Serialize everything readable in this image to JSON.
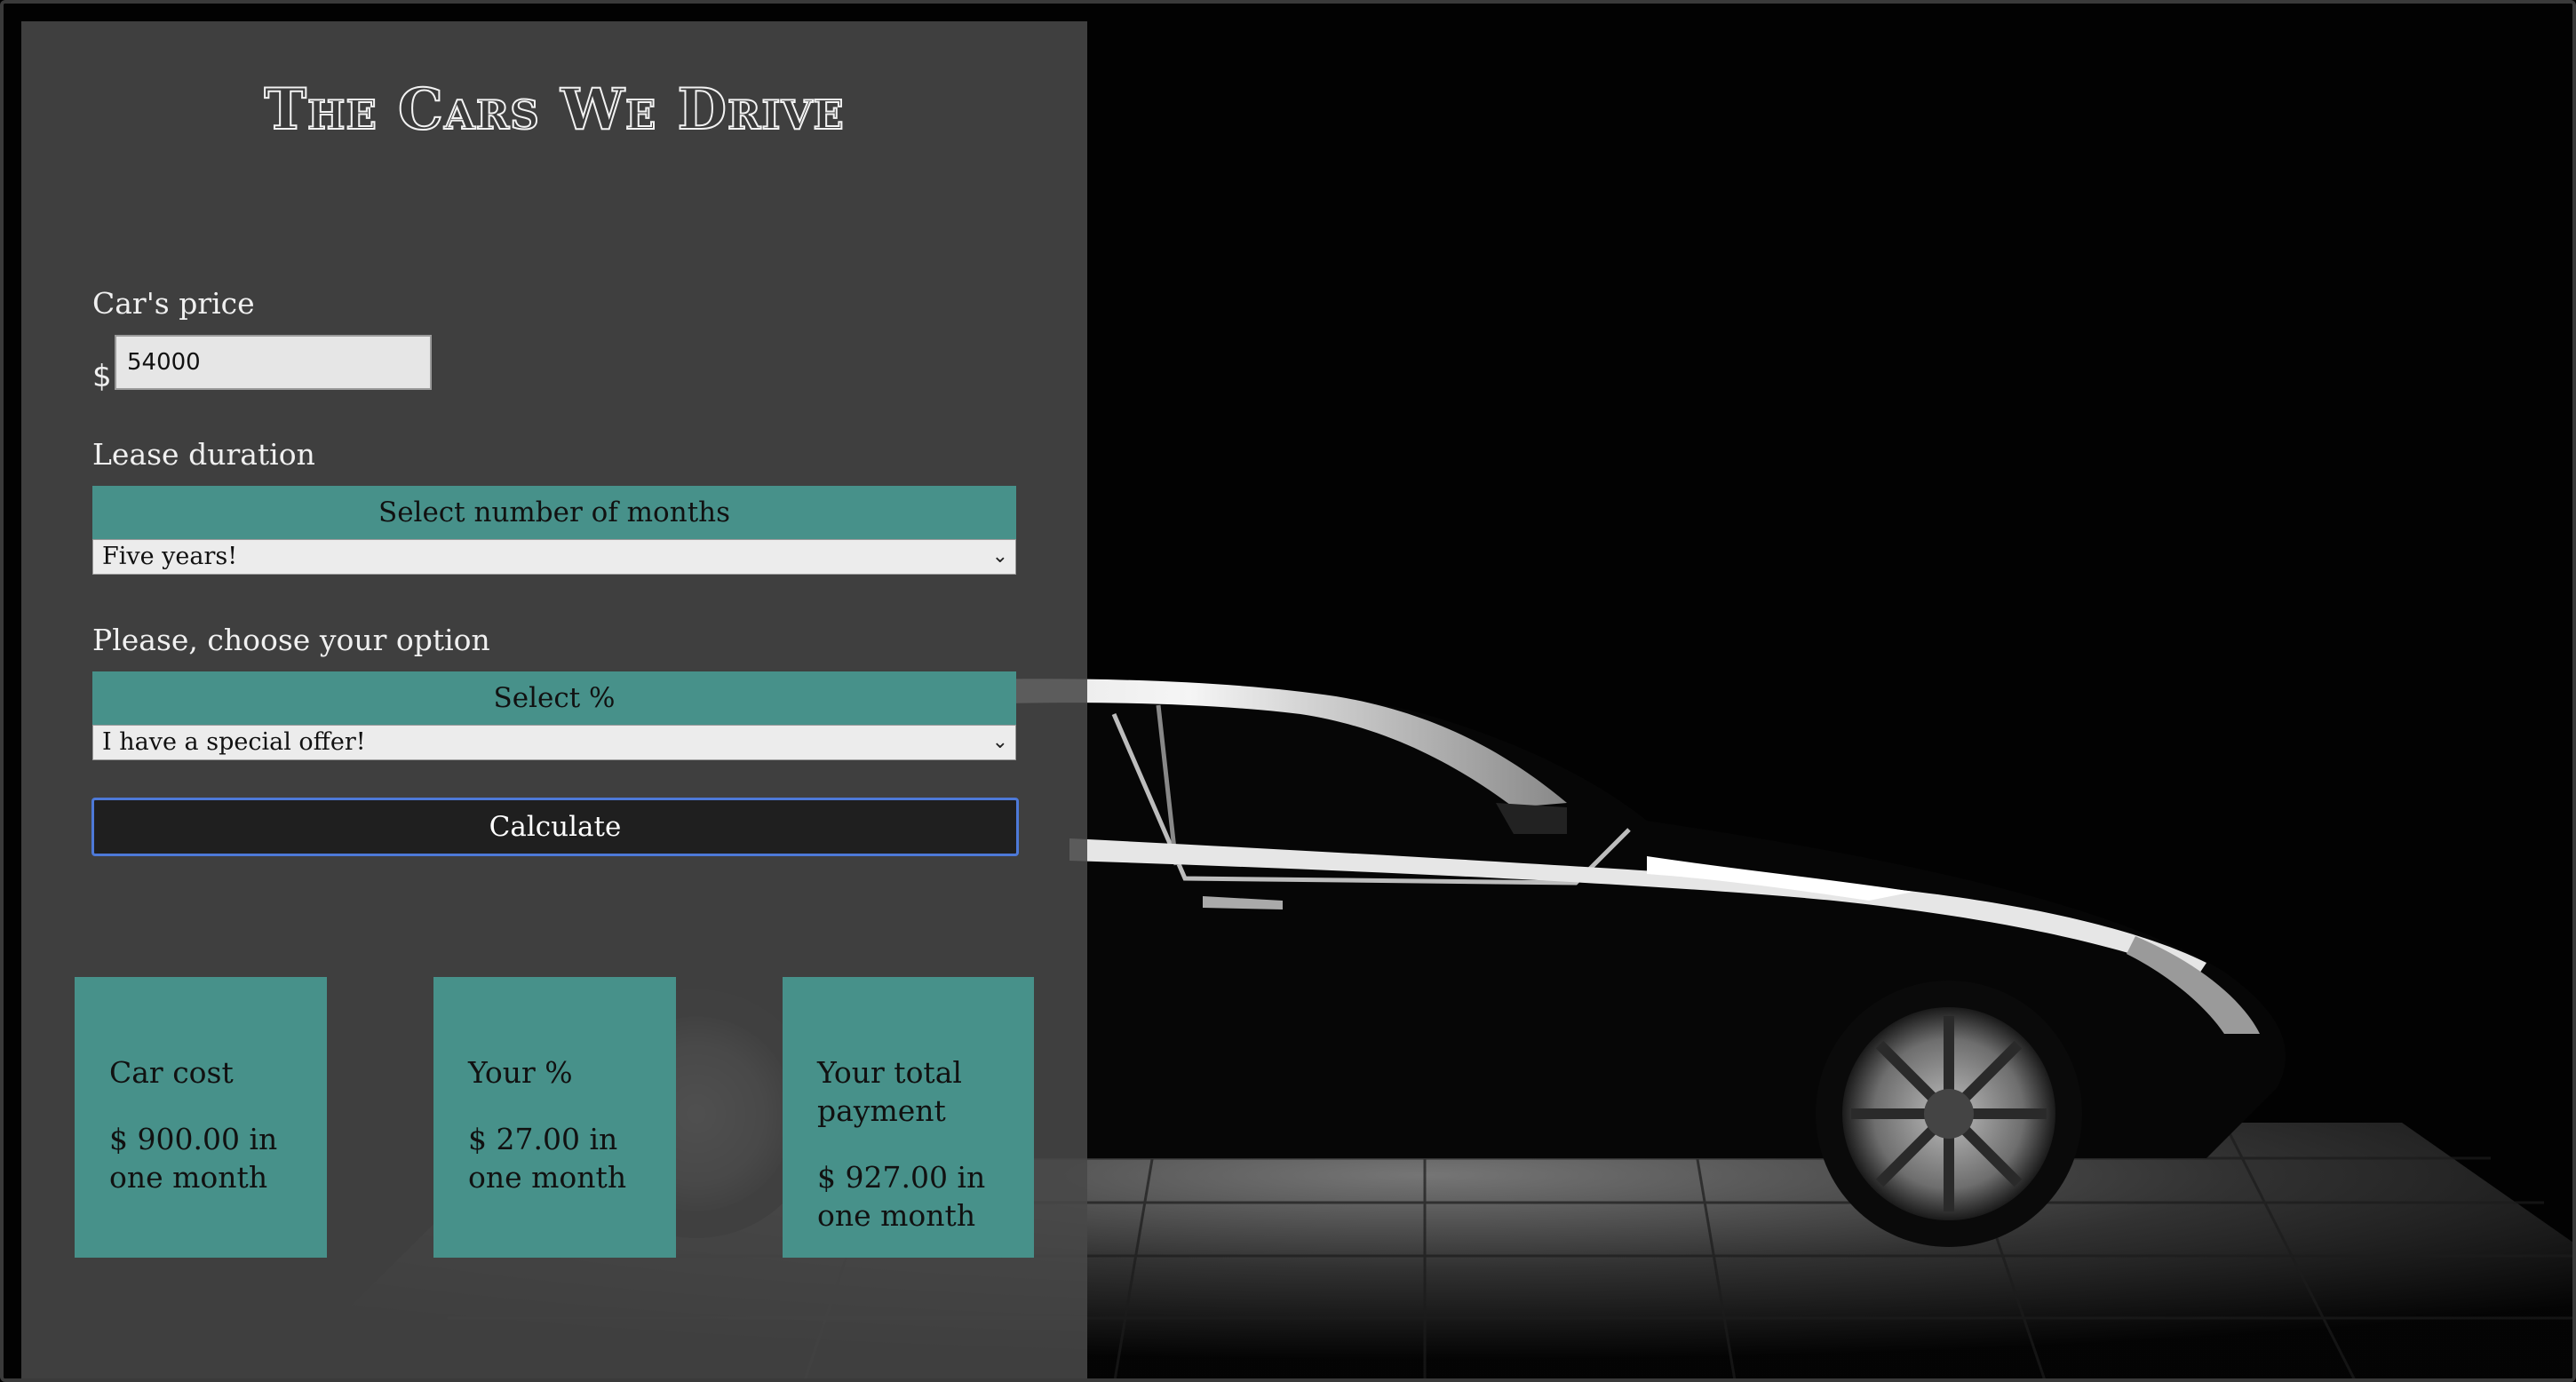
{
  "app": {
    "title": "The Cars We Drive"
  },
  "form": {
    "price_label": "Car's price",
    "currency_symbol": "$",
    "price_value": "54000",
    "lease_label": "Lease duration",
    "lease_header": "Select number of months",
    "lease_selected": "Five years!",
    "option_label": "Please, choose your option",
    "option_header": "Select %",
    "option_selected": "I have a special offer!",
    "calculate_label": "Calculate"
  },
  "results": [
    {
      "title": "Car cost",
      "value": "$ 900.00 in one month"
    },
    {
      "title": "Your %",
      "value": "$ 27.00 in one month"
    },
    {
      "title": "Your total payment",
      "value": "$ 927.00 in one month"
    }
  ],
  "icons": {
    "dropdown": "chevron-down-icon"
  },
  "colors": {
    "panel": "#484848",
    "accent": "#47918a",
    "button": "#1f1f1f",
    "focus_ring": "#4d79d8"
  }
}
